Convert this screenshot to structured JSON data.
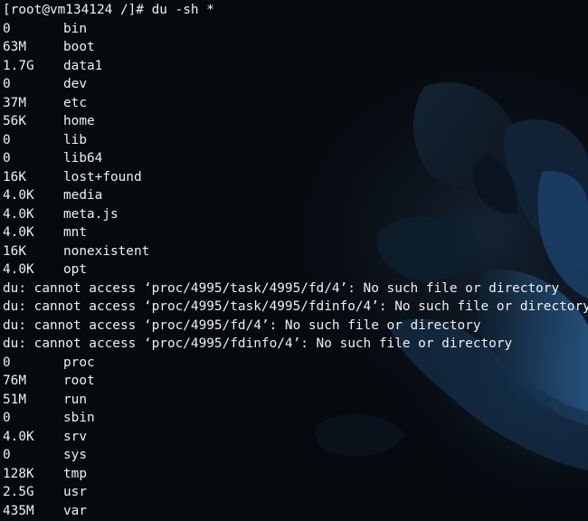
{
  "terminal": {
    "prompt": "[root@vm134124 /]# du -sh *",
    "lines": [
      {
        "kind": "entry",
        "size": "0",
        "name": "bin"
      },
      {
        "kind": "entry",
        "size": "63M",
        "name": "boot"
      },
      {
        "kind": "entry",
        "size": "1.7G",
        "name": "data1"
      },
      {
        "kind": "entry",
        "size": "0",
        "name": "dev"
      },
      {
        "kind": "entry",
        "size": "37M",
        "name": "etc"
      },
      {
        "kind": "entry",
        "size": "56K",
        "name": "home"
      },
      {
        "kind": "entry",
        "size": "0",
        "name": "lib"
      },
      {
        "kind": "entry",
        "size": "0",
        "name": "lib64"
      },
      {
        "kind": "entry",
        "size": "16K",
        "name": "lost+found"
      },
      {
        "kind": "entry",
        "size": "4.0K",
        "name": "media"
      },
      {
        "kind": "entry",
        "size": "4.0K",
        "name": "meta.js"
      },
      {
        "kind": "entry",
        "size": "4.0K",
        "name": "mnt"
      },
      {
        "kind": "entry",
        "size": "16K",
        "name": "nonexistent"
      },
      {
        "kind": "entry",
        "size": "4.0K",
        "name": "opt"
      },
      {
        "kind": "error",
        "text": "du: cannot access ‘proc/4995/task/4995/fd/4’: No such file or directory"
      },
      {
        "kind": "error",
        "text": "du: cannot access ‘proc/4995/task/4995/fdinfo/4’: No such file or directory"
      },
      {
        "kind": "error",
        "text": "du: cannot access ‘proc/4995/fd/4’: No such file or directory"
      },
      {
        "kind": "error",
        "text": "du: cannot access ‘proc/4995/fdinfo/4’: No such file or directory"
      },
      {
        "kind": "entry",
        "size": "0",
        "name": "proc"
      },
      {
        "kind": "entry",
        "size": "76M",
        "name": "root"
      },
      {
        "kind": "entry",
        "size": "51M",
        "name": "run"
      },
      {
        "kind": "entry",
        "size": "0",
        "name": "sbin"
      },
      {
        "kind": "entry",
        "size": "4.0K",
        "name": "srv"
      },
      {
        "kind": "entry",
        "size": "0",
        "name": "sys"
      },
      {
        "kind": "entry",
        "size": "128K",
        "name": "tmp"
      },
      {
        "kind": "entry",
        "size": "2.5G",
        "name": "usr"
      },
      {
        "kind": "entry",
        "size": "435M",
        "name": "var"
      }
    ]
  },
  "colors": {
    "background": "#06090d",
    "text": "#eef0f2",
    "wallpaper_accent": "#1b3a5c"
  }
}
